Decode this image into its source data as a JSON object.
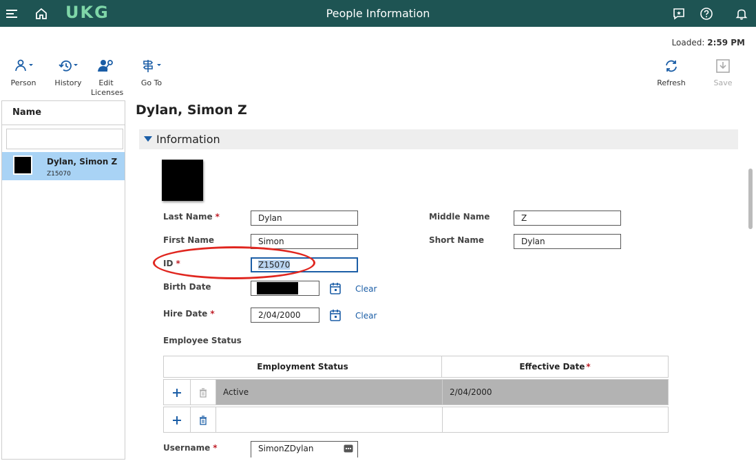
{
  "topbar": {
    "title": "People Information",
    "logo": "UKG",
    "icons": [
      "menu-icon",
      "home-icon",
      "chat-icon",
      "help-icon",
      "bell-icon"
    ]
  },
  "loaded": {
    "label": "Loaded:",
    "time": "2:59 PM"
  },
  "toolbar": {
    "person": "Person",
    "history": "History",
    "edit_licenses": "Edit Licenses",
    "goto": "Go To",
    "refresh": "Refresh",
    "save": "Save"
  },
  "left_panel": {
    "header": "Name",
    "search_placeholder": "",
    "items": [
      {
        "name": "Dylan, Simon Z",
        "id": "Z15070"
      }
    ]
  },
  "page_title": "Dylan, Simon Z",
  "section_title": "Information",
  "form": {
    "last_name_label": "Last Name",
    "last_name": "Dylan",
    "first_name_label": "First Name",
    "first_name": "Simon",
    "id_label": "ID",
    "id": "Z15070",
    "birth_date_label": "Birth Date",
    "hire_date_label": "Hire Date",
    "hire_date": "2/04/2000",
    "clear_label": "Clear",
    "middle_name_label": "Middle Name",
    "middle_name": "Z",
    "short_name_label": "Short Name",
    "short_name": "Dylan",
    "employee_status_label": "Employee Status",
    "username_label": "Username",
    "username": "SimonZDylan",
    "required_mark": "*"
  },
  "status_table": {
    "headers": [
      "Employment Status",
      "Effective Date"
    ],
    "rows": [
      {
        "status": "Active",
        "date": "2/04/2000"
      },
      {
        "status": "",
        "date": ""
      }
    ]
  },
  "colors": {
    "topbar": "#1e5453",
    "accent": "#1a5da6",
    "required": "#c0202a",
    "annotation": "#e0261f"
  }
}
